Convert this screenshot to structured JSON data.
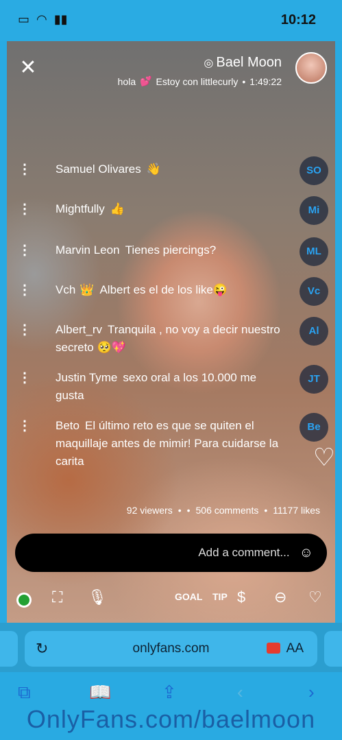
{
  "status": {
    "time": "10:12",
    "icons": [
      "battery-icon",
      "wifi-icon",
      "signal-icon"
    ]
  },
  "stream": {
    "close_label": "✕",
    "name": "Bael Moon",
    "verified_icon": "verified-icon",
    "duration": "1:49:22",
    "subtitle": "Estoy con littlecurly",
    "subtitle_emoji": "💕",
    "subtitle_tail": "hola"
  },
  "comments": [
    {
      "initials": "SO",
      "user": "Samuel Olivares",
      "text": "👋"
    },
    {
      "initials": "Mi",
      "user": "Mightfully",
      "text": "👍"
    },
    {
      "initials": "ML",
      "user": "Marvin Leon",
      "text": "Tienes piercings?"
    },
    {
      "initials": "Vc",
      "user": "Vch",
      "badge": "👑",
      "text": "Albert es el de los like😜"
    },
    {
      "initials": "Al",
      "user": "Albert_rv",
      "text": "Tranquila , no voy a decir nuestro secreto 🥺💖"
    },
    {
      "initials": "JT",
      "user": "Justin Tyme",
      "text": "sexo oral a los 10.000 me gusta"
    },
    {
      "initials": "Be",
      "user": "Beto",
      "text": "El último reto es que se quiten el maquillaje antes de mimir! Para cuidarse la carita"
    }
  ],
  "stats": {
    "likes": "11177 likes",
    "comments": "506 comments",
    "viewers": "92 viewers"
  },
  "comment_input": {
    "placeholder": "Add a comment..."
  },
  "controls": {
    "tip": "TIP",
    "goal": "GOAL"
  },
  "browser": {
    "url": "onlyfans.com",
    "aa": "AA",
    "reload": "↻"
  },
  "watermark": "OnlyFans.com/baelmoon"
}
